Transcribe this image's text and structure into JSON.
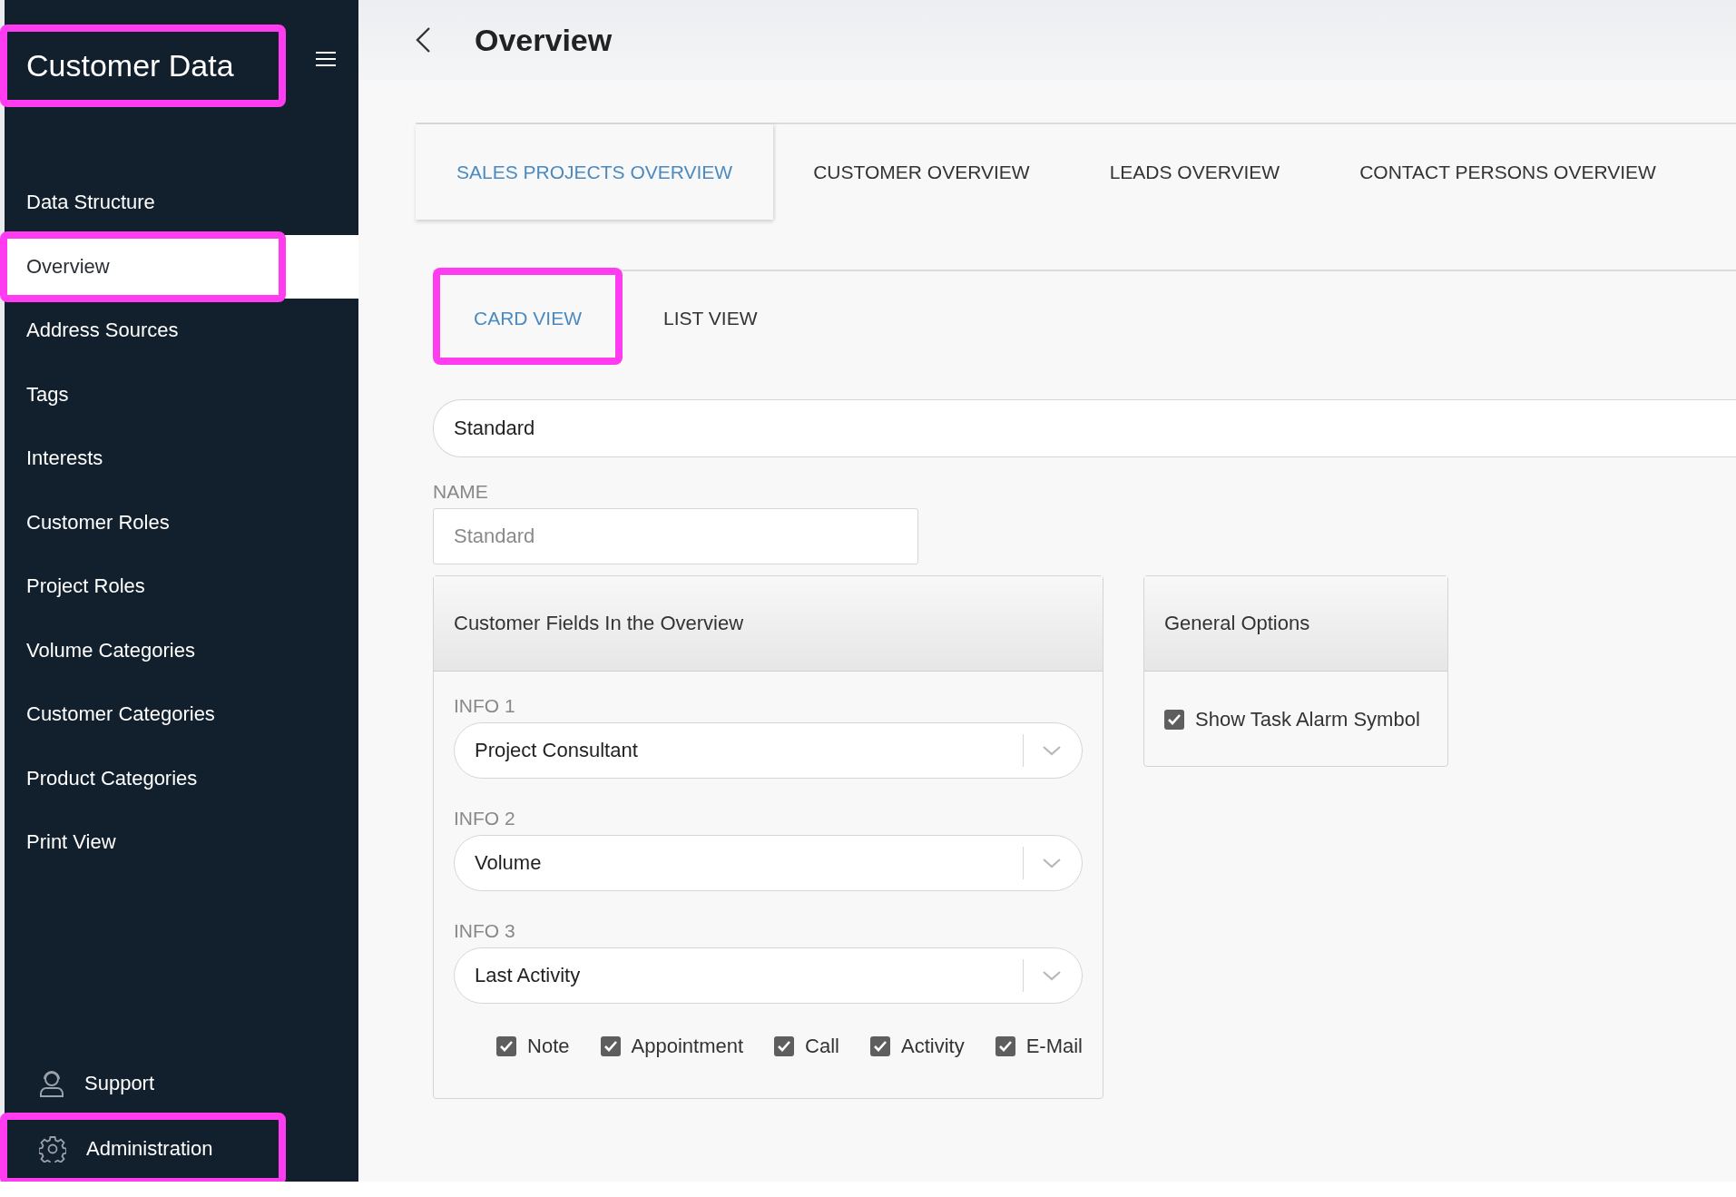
{
  "sidebar": {
    "title": "Customer Data",
    "title_highlighted": true,
    "items": [
      {
        "label": "Data Structure",
        "selected": false,
        "highlighted": false
      },
      {
        "label": "Overview",
        "selected": true,
        "highlighted": true
      },
      {
        "label": "Address Sources",
        "selected": false,
        "highlighted": false
      },
      {
        "label": "Tags",
        "selected": false,
        "highlighted": false
      },
      {
        "label": "Interests",
        "selected": false,
        "highlighted": false
      },
      {
        "label": "Customer Roles",
        "selected": false,
        "highlighted": false
      },
      {
        "label": "Project Roles",
        "selected": false,
        "highlighted": false
      },
      {
        "label": "Volume Categories",
        "selected": false,
        "highlighted": false
      },
      {
        "label": "Customer Categories",
        "selected": false,
        "highlighted": false
      },
      {
        "label": "Product Categories",
        "selected": false,
        "highlighted": false
      },
      {
        "label": "Print View",
        "selected": false,
        "highlighted": false
      }
    ],
    "footer_items": [
      {
        "label": "Support",
        "kind": "support",
        "highlighted": false
      },
      {
        "label": "Administration",
        "kind": "settings",
        "highlighted": true
      }
    ]
  },
  "header": {
    "title": "Overview"
  },
  "tabs": [
    {
      "label": "SALES PROJECTS OVERVIEW",
      "selected": true
    },
    {
      "label": "CUSTOMER OVERVIEW",
      "selected": false
    },
    {
      "label": "LEADS OVERVIEW",
      "selected": false
    },
    {
      "label": "CONTACT PERSONS OVERVIEW",
      "selected": false
    }
  ],
  "view_tabs": [
    {
      "label": "CARD VIEW",
      "selected": true,
      "highlighted": true
    },
    {
      "label": "LIST VIEW",
      "selected": false,
      "highlighted": false
    }
  ],
  "layout_select": {
    "value": "Standard"
  },
  "name_field": {
    "label": "NAME",
    "placeholder": "Standard"
  },
  "fields_card": {
    "title": "Customer Fields In the Overview",
    "fields": [
      {
        "label": "INFO 1",
        "value": "Project Consultant"
      },
      {
        "label": "INFO 2",
        "value": "Volume"
      },
      {
        "label": "INFO 3",
        "value": "Last Activity"
      }
    ],
    "checkboxes": [
      {
        "label": "Note",
        "checked": true
      },
      {
        "label": "Appointment",
        "checked": true
      },
      {
        "label": "Call",
        "checked": true
      },
      {
        "label": "Activity",
        "checked": true
      },
      {
        "label": "E-Mail",
        "checked": true
      }
    ]
  },
  "options_card": {
    "title": "General Options",
    "checkboxes": [
      {
        "label": "Show Task Alarm Symbol",
        "checked": true
      }
    ]
  }
}
